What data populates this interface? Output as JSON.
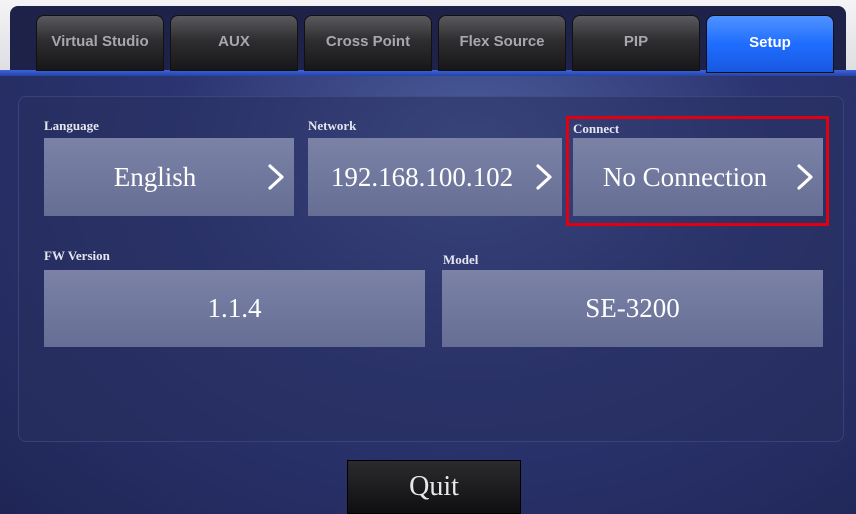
{
  "tabs": [
    {
      "label": "Virtual Studio"
    },
    {
      "label": "AUX"
    },
    {
      "label": "Cross Point"
    },
    {
      "label": "Flex Source"
    },
    {
      "label": "PIP"
    },
    {
      "label": "Setup",
      "active": true
    }
  ],
  "setup": {
    "language": {
      "label": "Language",
      "value": "English"
    },
    "network": {
      "label": "Network",
      "value": "192.168.100.102"
    },
    "connect": {
      "label": "Connect",
      "value": "No Connection"
    },
    "fw_version": {
      "label": "FW Version",
      "value": "1.1.4"
    },
    "model": {
      "label": "Model",
      "value": "SE-3200"
    }
  },
  "footer": {
    "quit_label": "Quit"
  },
  "colors": {
    "active_tab": "#1f6dff",
    "highlight": "#e00010",
    "field_bg": "#7b82a6"
  }
}
